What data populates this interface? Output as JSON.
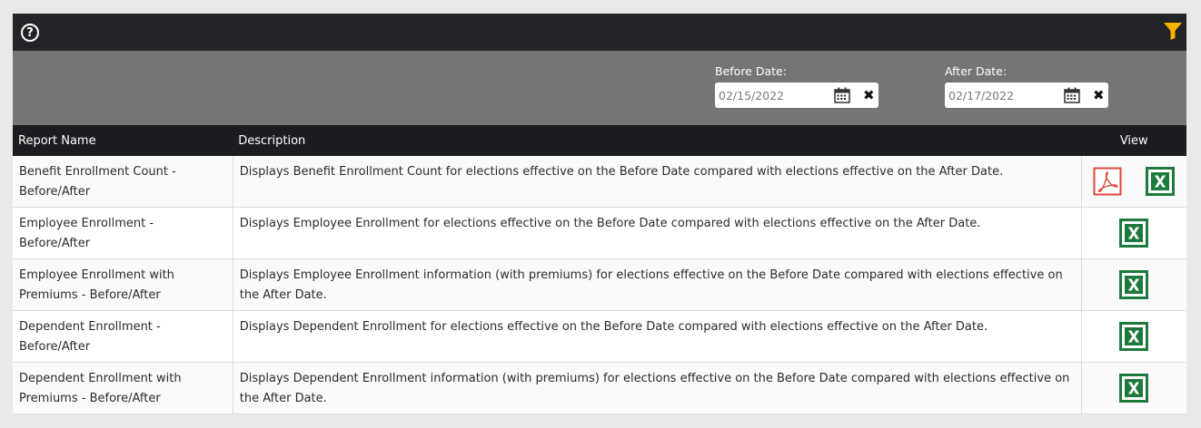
{
  "toolbar": {
    "help_symbol": "?",
    "help_icon": "help-circle-icon",
    "filter_icon": "filter-icon",
    "filter_color": "#f5b400"
  },
  "filters": {
    "before": {
      "label": "Before Date:",
      "value": "02/15/2022"
    },
    "after": {
      "label": "After Date:",
      "value": "02/17/2022"
    },
    "clear_symbol": "✖"
  },
  "table": {
    "headers": {
      "name": "Report Name",
      "description": "Description",
      "view": "View"
    },
    "rows": [
      {
        "name": "Benefit Enrollment Count - Before/After",
        "description": "Displays Benefit Enrollment Count for elections effective on the Before Date compared with elections effective on the After Date.",
        "views": [
          "pdf",
          "excel"
        ]
      },
      {
        "name": "Employee Enrollment - Before/After",
        "description": "Displays Employee Enrollment for elections effective on the Before Date compared with elections effective on the After Date.",
        "views": [
          "excel"
        ]
      },
      {
        "name": "Employee Enrollment with Premiums - Before/After",
        "description": "Displays Employee Enrollment information (with premiums) for elections effective on the Before Date compared with elections effective on the After Date.",
        "views": [
          "excel"
        ]
      },
      {
        "name": "Dependent Enrollment - Before/After",
        "description": "Displays Dependent Enrollment for elections effective on the Before Date compared with elections effective on the After Date.",
        "views": [
          "excel"
        ]
      },
      {
        "name": "Dependent Enrollment with Premiums - Before/After",
        "description": "Displays Dependent Enrollment information (with premiums) for elections effective on the Before Date compared with elections effective on the After Date.",
        "views": [
          "excel"
        ]
      }
    ]
  },
  "colors": {
    "excel": "#1e7a3c",
    "pdf": "#e0463c",
    "header_bg": "#1c1d20",
    "filter_bg": "#757575"
  }
}
